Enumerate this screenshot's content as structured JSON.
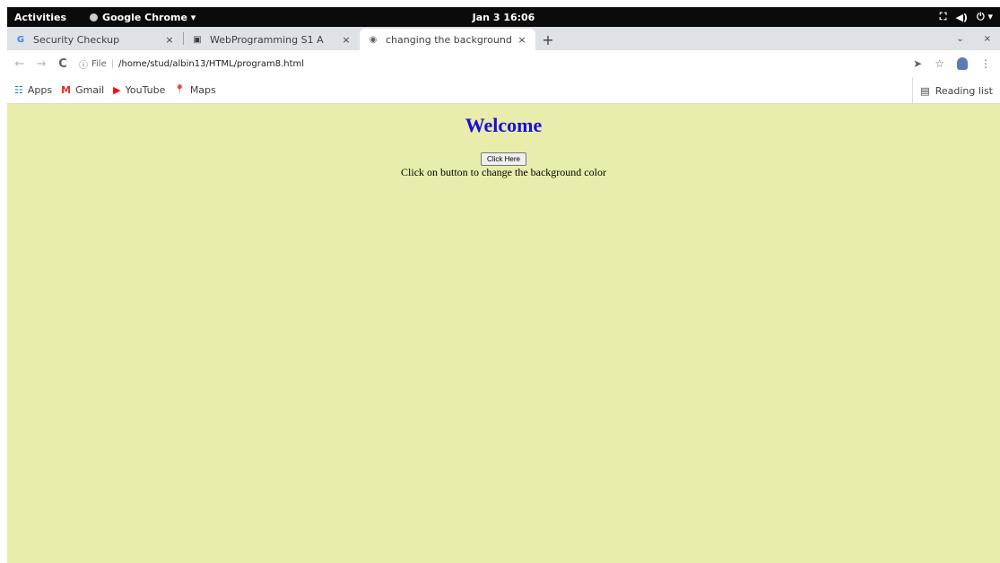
{
  "topbar": {
    "activities": "Activities",
    "app_name": "Google Chrome ▾",
    "clock": "Jan 3  16:06",
    "tray": [
      "⛶",
      "◀)",
      "⏻ ▾"
    ]
  },
  "tabs": [
    {
      "favicon": "G",
      "title": "Security Checkup",
      "close": "×"
    },
    {
      "favicon": "▣",
      "title": "WebProgramming S1 A",
      "close": "×"
    },
    {
      "favicon": "◉",
      "title": "changing the background",
      "close": "×"
    }
  ],
  "tabstrip": {
    "new_tab": "+",
    "tab_search": "⌄",
    "window_close": "×"
  },
  "toolbar": {
    "back": "←",
    "forward": "→",
    "reload": "C",
    "info_icon": "ⓘ",
    "scheme": "File",
    "url": "/home/stud/albin13/HTML/program8.html",
    "send": "➤",
    "star": "☆",
    "menu": "⋮"
  },
  "bookmarks": [
    {
      "icon": "☷",
      "label": "Apps",
      "color": "#1a73e8"
    },
    {
      "icon": "M",
      "label": "Gmail",
      "color": "#d93025"
    },
    {
      "icon": "▶",
      "label": "YouTube",
      "color": "#ff0000"
    },
    {
      "icon": "📍",
      "label": "Maps",
      "color": "#34a853"
    }
  ],
  "reading_list": {
    "icon": "▤",
    "label": "Reading list"
  },
  "page": {
    "heading": "Welcome",
    "button_label": "Click Here",
    "message": "Click on button to change the background color",
    "background": "#e8edac",
    "heading_color": "#1a0fd6"
  }
}
